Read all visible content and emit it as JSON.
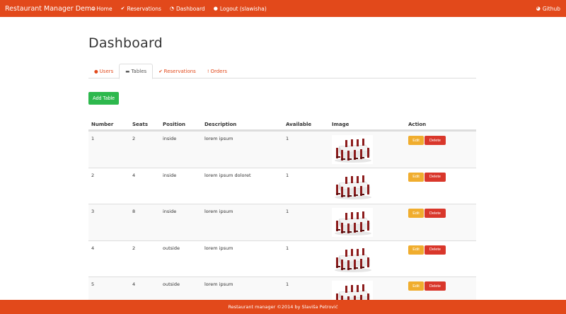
{
  "navbar": {
    "brand": "Restaurant Manager Demo",
    "items": [
      {
        "icon": "home-icon",
        "glyph": "⌂",
        "label": "Home"
      },
      {
        "icon": "check-icon",
        "glyph": "✔",
        "label": "Reservations"
      },
      {
        "icon": "dashboard-icon",
        "glyph": "◔",
        "label": "Dashboard"
      },
      {
        "icon": "user-icon",
        "glyph": "●",
        "label": "Logout (slawisha)"
      }
    ],
    "github": {
      "icon": "github-icon",
      "glyph": "◕",
      "label": "Github"
    }
  },
  "page": {
    "title": "Dashboard"
  },
  "tabs": [
    {
      "icon": "user-icon",
      "glyph": "●",
      "label": "Users",
      "active": false
    },
    {
      "icon": "table-icon",
      "glyph": "▬",
      "label": "Tables",
      "active": true
    },
    {
      "icon": "check-icon",
      "glyph": "✔",
      "label": "Reservations",
      "active": false
    },
    {
      "icon": "exclamation-icon",
      "glyph": "!",
      "label": "Orders",
      "active": false
    }
  ],
  "add_button": "Add Table",
  "table": {
    "headers": {
      "number": "Number",
      "seats": "Seats",
      "position": "Position",
      "description": "Description",
      "available": "Available",
      "image": "Image",
      "action": "Action"
    },
    "rows": [
      {
        "number": "1",
        "seats": "2",
        "position": "inside",
        "description": "lorem ipsum",
        "available": "1"
      },
      {
        "number": "2",
        "seats": "4",
        "position": "inside",
        "description": "lorem ipsum doloret",
        "available": "1"
      },
      {
        "number": "3",
        "seats": "8",
        "position": "inside",
        "description": "lorem ipsum",
        "available": "1"
      },
      {
        "number": "4",
        "seats": "2",
        "position": "outside",
        "description": "lorem ipsum",
        "available": "1"
      },
      {
        "number": "5",
        "seats": "4",
        "position": "outside",
        "description": "lorem ipsum",
        "available": "1"
      }
    ],
    "edit_label": "Edit",
    "delete_label": "Delete"
  },
  "footer": {
    "text": "Restaurant manager ©2014 by Slaviša Petrović"
  },
  "colors": {
    "primary": "#e2491b",
    "success": "#2db84d",
    "warning": "#f0ad2e",
    "danger": "#d9372b"
  }
}
